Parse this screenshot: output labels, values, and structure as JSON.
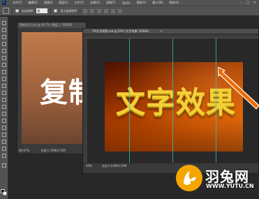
{
  "menubar": {
    "logo": "Ps",
    "items": [
      "文件(F)",
      "编辑(E)",
      "图像(I)",
      "图层(L)",
      "文字(Y)",
      "选择(S)",
      "滤镜(T)",
      "3D(D)",
      "视图(V)",
      "窗口(W)",
      "帮助(H)"
    ],
    "window_controls": [
      "–",
      "▢",
      "✕"
    ]
  },
  "optbar": {
    "auto_select_label": "自动选择:",
    "auto_select_value": "组",
    "show_transform_label": "显示变换控件"
  },
  "doc1": {
    "tab_title": "复制文字.png @ 66.7% (图层 1, RGB/8)",
    "big_text": "复制",
    "zoom": "66.67%",
    "doc_info": "文档:1.72M/4.72M"
  },
  "doc2": {
    "tab_title": "PS文字效果.psd @ 50% (文字效果, RGB/8)",
    "tab_close": "×",
    "effect_text": "文字效果",
    "zoom": "50%",
    "doc_info": "文档:1.03M/3.15M"
  },
  "watermark": {
    "logo_name": "yutu-rabbit-logo",
    "brand_cn": "羽兔网",
    "url": "WWW.YUTU.CN"
  },
  "colors": {
    "accent_orange": "#f06a00",
    "guide": "#28c9c0",
    "text_gold": "#f4d038"
  }
}
